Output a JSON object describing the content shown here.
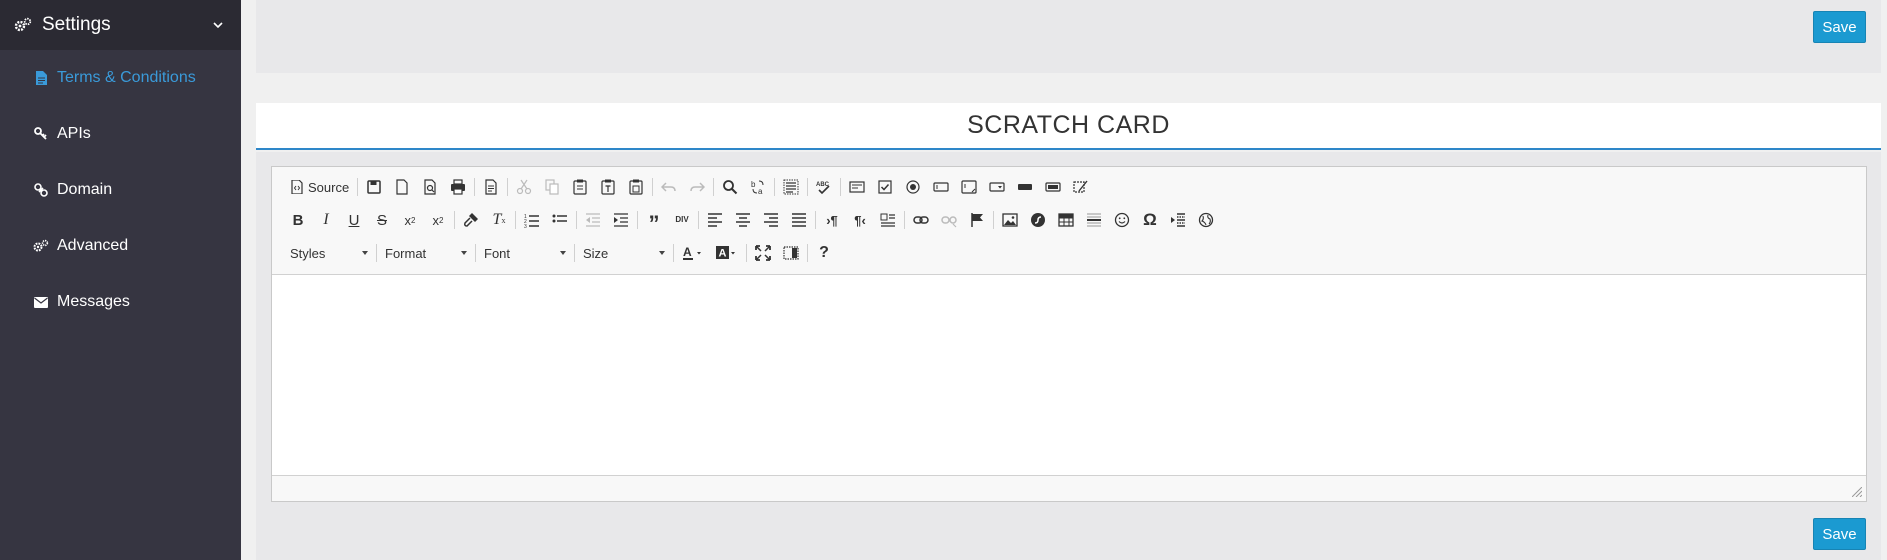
{
  "sidebar": {
    "header": {
      "title": "Settings",
      "icon": "gears-icon"
    },
    "items": [
      {
        "label": "Terms & Conditions",
        "icon": "file-icon",
        "active": true
      },
      {
        "label": "APIs",
        "icon": "key-icon"
      },
      {
        "label": "Domain",
        "icon": "link-icon"
      },
      {
        "label": "Advanced",
        "icon": "gears-icon"
      },
      {
        "label": "Messages",
        "icon": "envelope-icon"
      }
    ]
  },
  "top_panel": {
    "save_label": "Save"
  },
  "card": {
    "title": "SCRATCH CARD",
    "save_label": "Save"
  },
  "editor": {
    "source_label": "Source",
    "combos": {
      "styles": "Styles",
      "format": "Format",
      "font": "Font",
      "size": "Size"
    },
    "content": ""
  },
  "colors": {
    "sidebar_bg": "#363541",
    "sidebar_header_bg": "#2b2a33",
    "accent": "#1b9ad1",
    "active_link": "#3a9ad9",
    "panel_bg": "#e8e8ea"
  }
}
